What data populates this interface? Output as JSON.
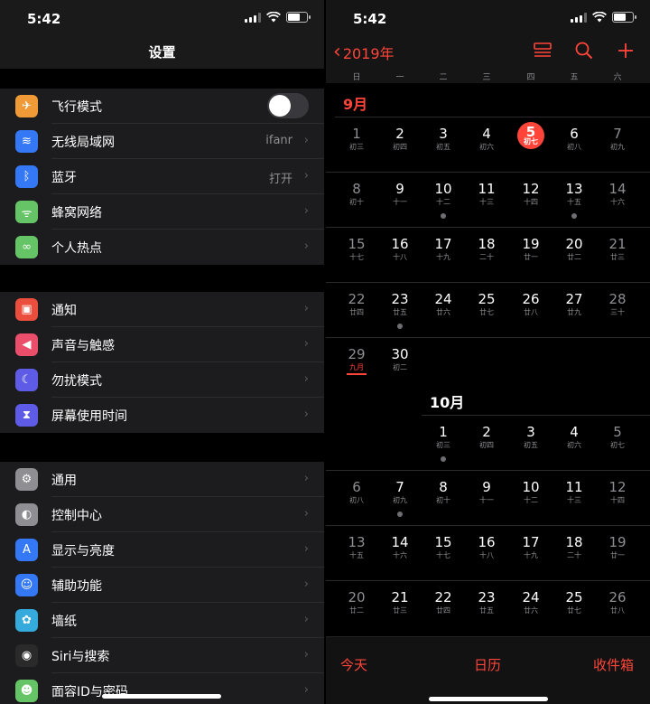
{
  "left": {
    "status": {
      "time": "5:42"
    },
    "title": "设置",
    "groups": [
      [
        {
          "label": "飞行模式",
          "icon": "airplane-icon",
          "color": "#f09a37",
          "toggle": true
        },
        {
          "label": "无线局域网",
          "icon": "wifi-icon",
          "color": "#3478f6",
          "value": "ifanr"
        },
        {
          "label": "蓝牙",
          "icon": "bluetooth-icon",
          "color": "#3478f6",
          "value": "打开"
        },
        {
          "label": "蜂窝网络",
          "icon": "cellular-icon",
          "color": "#65c466"
        },
        {
          "label": "个人热点",
          "icon": "hotspot-icon",
          "color": "#65c466"
        }
      ],
      [
        {
          "label": "通知",
          "icon": "notifications-icon",
          "color": "#eb4e3d"
        },
        {
          "label": "声音与触感",
          "icon": "sound-icon",
          "color": "#eb4e6a"
        },
        {
          "label": "勿扰模式",
          "icon": "moon-icon",
          "color": "#5e5ce6"
        },
        {
          "label": "屏幕使用时间",
          "icon": "hourglass-icon",
          "color": "#5e5ce6"
        }
      ],
      [
        {
          "label": "通用",
          "icon": "gear-icon",
          "color": "#8e8e93"
        },
        {
          "label": "控制中心",
          "icon": "control-center-icon",
          "color": "#8e8e93"
        },
        {
          "label": "显示与亮度",
          "icon": "display-icon",
          "color": "#3478f6"
        },
        {
          "label": "辅助功能",
          "icon": "accessibility-icon",
          "color": "#3478f6"
        },
        {
          "label": "墙纸",
          "icon": "wallpaper-icon",
          "color": "#35aadc"
        },
        {
          "label": "Siri与搜索",
          "icon": "siri-icon",
          "color": "#2a2a2a"
        },
        {
          "label": "面容ID与密码",
          "icon": "faceid-icon",
          "color": "#65c466"
        }
      ]
    ]
  },
  "right": {
    "status": {
      "time": "5:42"
    },
    "year_label": "2019年",
    "weekdays": [
      "日",
      "一",
      "二",
      "三",
      "四",
      "五",
      "六"
    ],
    "months": [
      {
        "label": "9月",
        "accent": "#ff453a",
        "first_weekday": 0,
        "days": [
          {
            "n": "1",
            "l": "初三"
          },
          {
            "n": "2",
            "l": "初四"
          },
          {
            "n": "3",
            "l": "初五"
          },
          {
            "n": "4",
            "l": "初六"
          },
          {
            "n": "5",
            "l": "初七",
            "today": true
          },
          {
            "n": "6",
            "l": "初八"
          },
          {
            "n": "7",
            "l": "初九"
          },
          {
            "n": "8",
            "l": "初十"
          },
          {
            "n": "9",
            "l": "十一"
          },
          {
            "n": "10",
            "l": "十二",
            "dot": true
          },
          {
            "n": "11",
            "l": "十三"
          },
          {
            "n": "12",
            "l": "十四"
          },
          {
            "n": "13",
            "l": "十五",
            "dot": true
          },
          {
            "n": "14",
            "l": "十六"
          },
          {
            "n": "15",
            "l": "十七"
          },
          {
            "n": "16",
            "l": "十八"
          },
          {
            "n": "17",
            "l": "十九"
          },
          {
            "n": "18",
            "l": "二十"
          },
          {
            "n": "19",
            "l": "廿一"
          },
          {
            "n": "20",
            "l": "廿二"
          },
          {
            "n": "21",
            "l": "廿三"
          },
          {
            "n": "22",
            "l": "廿四"
          },
          {
            "n": "23",
            "l": "廿五",
            "dot": true
          },
          {
            "n": "24",
            "l": "廿六"
          },
          {
            "n": "25",
            "l": "廿七"
          },
          {
            "n": "26",
            "l": "廿八"
          },
          {
            "n": "27",
            "l": "廿九"
          },
          {
            "n": "28",
            "l": "三十"
          },
          {
            "n": "29",
            "l": "九月",
            "month_start": true
          },
          {
            "n": "30",
            "l": "初二"
          }
        ]
      },
      {
        "label": "10月",
        "accent": "#ffffff",
        "first_weekday": 2,
        "days": [
          {
            "n": "1",
            "l": "初三",
            "dot": true
          },
          {
            "n": "2",
            "l": "初四"
          },
          {
            "n": "3",
            "l": "初五"
          },
          {
            "n": "4",
            "l": "初六"
          },
          {
            "n": "5",
            "l": "初七"
          },
          {
            "n": "6",
            "l": "初八"
          },
          {
            "n": "7",
            "l": "初九",
            "dot": true
          },
          {
            "n": "8",
            "l": "初十"
          },
          {
            "n": "9",
            "l": "十一"
          },
          {
            "n": "10",
            "l": "十二"
          },
          {
            "n": "11",
            "l": "十三"
          },
          {
            "n": "12",
            "l": "十四"
          },
          {
            "n": "13",
            "l": "十五"
          },
          {
            "n": "14",
            "l": "十六"
          },
          {
            "n": "15",
            "l": "十七"
          },
          {
            "n": "16",
            "l": "十八"
          },
          {
            "n": "17",
            "l": "十九"
          },
          {
            "n": "18",
            "l": "二十"
          },
          {
            "n": "19",
            "l": "廿一"
          },
          {
            "n": "20",
            "l": "廿二"
          },
          {
            "n": "21",
            "l": "廿三"
          },
          {
            "n": "22",
            "l": "廿四"
          },
          {
            "n": "23",
            "l": "廿五"
          },
          {
            "n": "24",
            "l": "廿六"
          },
          {
            "n": "25",
            "l": "廿七"
          },
          {
            "n": "26",
            "l": "廿八"
          }
        ]
      }
    ],
    "tabs": [
      "今天",
      "日历",
      "收件箱"
    ],
    "accent": "#ff453a"
  }
}
